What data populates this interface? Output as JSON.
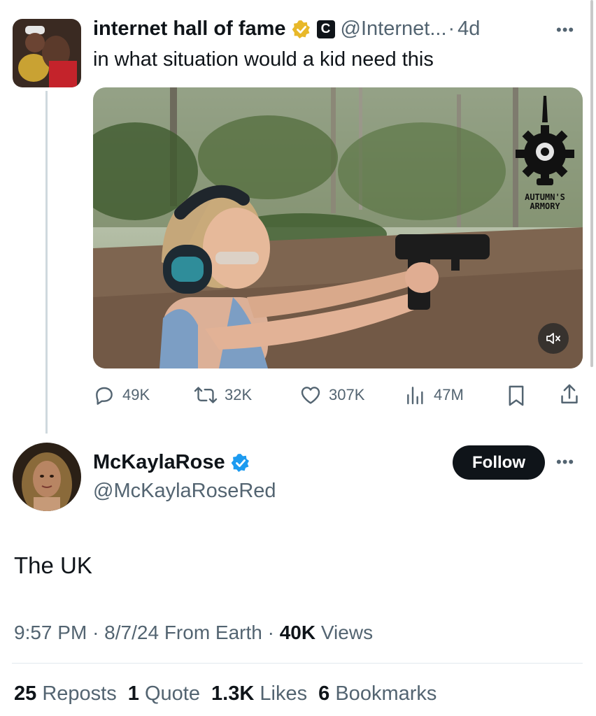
{
  "original_tweet": {
    "display_name": "internet hall of fame",
    "badge_letter": "C",
    "handle": "@Internet...",
    "separator": "·",
    "age": "4d",
    "text": "in what situation would a kid need this",
    "media": {
      "watermark_text": "AUTUMN'S ARMORY",
      "mute_icon": "speaker-muted-icon"
    },
    "stats": {
      "replies": "49K",
      "reposts": "32K",
      "likes": "307K",
      "views": "47M"
    }
  },
  "reply": {
    "display_name": "McKaylaRose",
    "handle": "@McKaylaRoseRed",
    "follow_label": "Follow",
    "text": "The UK",
    "time": "9:57 PM",
    "date": "8/7/24",
    "source": "From Earth",
    "dot": "·",
    "views_count": "40K",
    "views_label": "Views",
    "counts": {
      "reposts_count": "25",
      "reposts_label": "Reposts",
      "quotes_count": "1",
      "quotes_label": "Quote",
      "likes_count": "1.3K",
      "likes_label": "Likes",
      "bookmarks_count": "6",
      "bookmarks_label": "Bookmarks"
    }
  },
  "colors": {
    "text": "#0f1419",
    "muted": "#536471",
    "verified_gold": "#e8b829",
    "verified_blue": "#1d9bf0",
    "follow_bg": "#0f1419"
  }
}
